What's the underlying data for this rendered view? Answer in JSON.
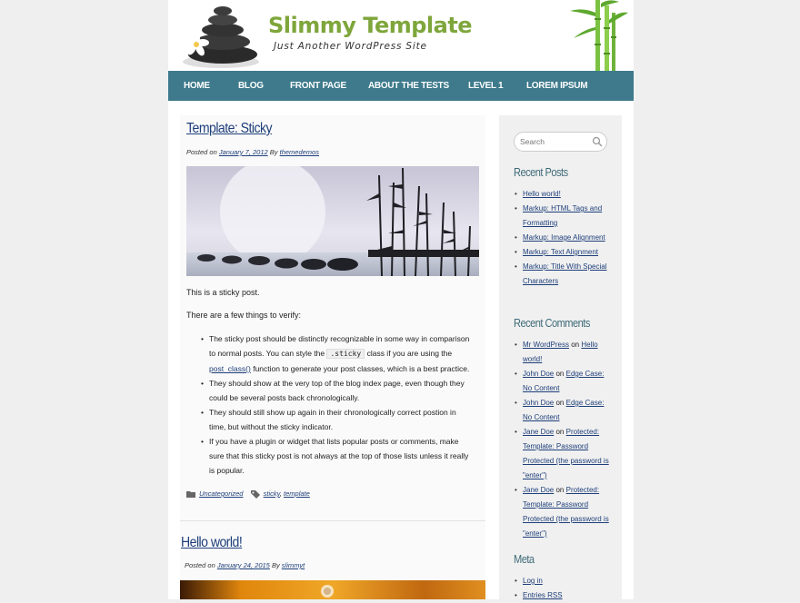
{
  "site": {
    "title": "Slimmy Template",
    "description": "Just Another WordPress Site"
  },
  "nav": [
    {
      "label": "HOME"
    },
    {
      "label": "BLOG"
    },
    {
      "label": "FRONT PAGE"
    },
    {
      "label": "ABOUT THE TESTS"
    },
    {
      "label": "LEVEL 1"
    },
    {
      "label": "LOREM IPSUM"
    }
  ],
  "post1": {
    "title": "Template: Sticky",
    "posted_on": "Posted on",
    "date": "January 7, 2012",
    "by": "By",
    "author": "themedemos",
    "intro": "This is a sticky post.",
    "lead": "There are a few things to verify:",
    "points": {
      "p1_a": "The sticky post should be distinctly recognizable in some way in comparison to normal posts. You can style the",
      "p1_code": ".sticky",
      "p1_b": "class if you are using the",
      "p1_link": "post_class()",
      "p1_c": "function to generate your post classes, which is a best practice.",
      "p2": "They should show at the very top of the blog index page, even though they could be several posts back chronologically.",
      "p3": "They should still show up again in their chronologically correct postion in time, but without the sticky indicator.",
      "p4": "If you have a plugin or widget that lists popular posts or comments, make sure that this sticky post is not always at the top of those lists unless it really is popular."
    },
    "category": "Uncategorized",
    "tag1": "sticky",
    "tag_sep": ",",
    "tag2": "template"
  },
  "post2": {
    "title": "Hello world!",
    "posted_on": "Posted on",
    "date": "January 24, 2015",
    "by": "By",
    "author": "slimmyt"
  },
  "sidebar": {
    "search_placeholder": "Search",
    "recent_posts_title": "Recent Posts",
    "recent_posts": [
      "Hello world!",
      "Markup: HTML Tags and Formatting",
      "Markup: Image Alignment",
      "Markup: Text Alignment",
      "Markup: Title With Special Characters"
    ],
    "recent_comments_title": "Recent Comments",
    "on": "on",
    "recent_comments": [
      {
        "author": "Mr WordPress",
        "post": "Hello world!"
      },
      {
        "author": "John Doe",
        "post": "Edge Case: No Content"
      },
      {
        "author": "John Doe",
        "post": "Edge Case: No Content"
      },
      {
        "author": "Jane Doe",
        "post": "Protected: Template: Password Protected (the password is \"enter\")"
      },
      {
        "author": "Jane Doe",
        "post": "Protected: Template: Password Protected (the password is \"enter\")"
      }
    ],
    "meta_title": "Meta",
    "meta": [
      "Log in",
      "Entries RSS"
    ]
  },
  "colors": {
    "nav_bg": "#3e7a8c",
    "title_green": "#7ea63b",
    "link": "#1e3f7a",
    "widget_title": "#3f6b78"
  },
  "icons": [
    "stones-logo",
    "bamboo-decor",
    "search-icon",
    "folder-icon",
    "tag-icon"
  ]
}
